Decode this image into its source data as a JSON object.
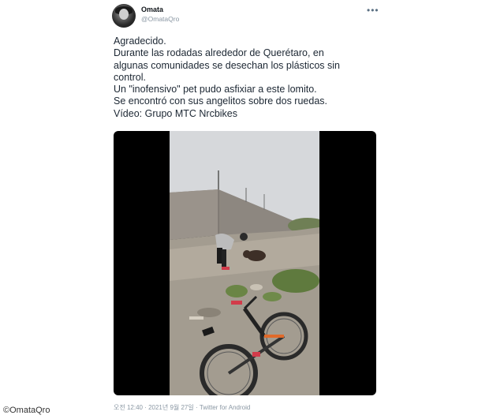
{
  "tweet": {
    "author_name": "Omata",
    "author_handle": "@OmataQro",
    "more_label": "•••",
    "text_lines": [
      "Agradecido.",
      "Durante las rodadas alrededor de Querétaro, en",
      "algunas comunidades se desechan los plásticos sin",
      "control.",
      "Un \"inofensivo\" pet pudo asfixiar a este lomito.",
      "Se encontró con sus angelitos sobre dos ruedas.",
      "Vídeo: Grupo MTC Nrcbikes"
    ],
    "meta": "오전 12:40 · 2021년 9월 27일 · Twitter for Android"
  },
  "watermark": "©OmataQro",
  "colors": {
    "text": "#0f1419",
    "muted": "#8a97a3",
    "video_bg": "#000000",
    "sky": "#d6d8db"
  }
}
